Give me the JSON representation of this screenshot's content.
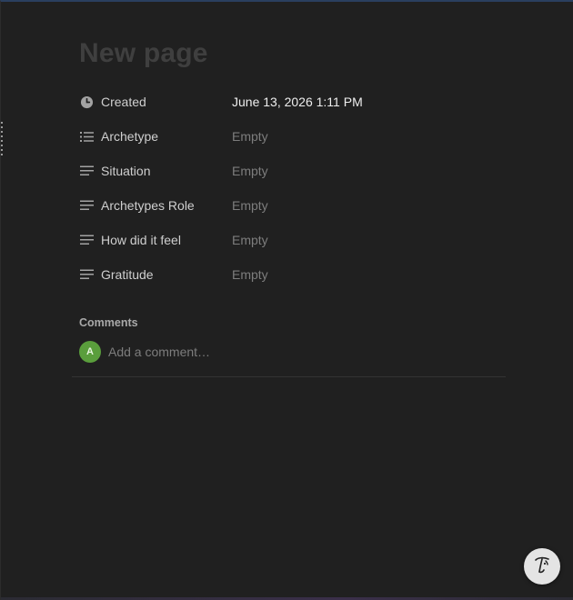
{
  "page": {
    "title": "New page"
  },
  "properties": [
    {
      "name": "Created",
      "value": "June 13, 2026 1:11 PM",
      "icon": "clock-icon",
      "filled": true
    },
    {
      "name": "Archetype",
      "value": "Empty",
      "icon": "list-icon",
      "filled": false
    },
    {
      "name": "Situation",
      "value": "Empty",
      "icon": "text-lines-icon",
      "filled": false
    },
    {
      "name": "Archetypes Role",
      "value": "Empty",
      "icon": "text-lines-icon",
      "filled": false
    },
    {
      "name": "How did it feel",
      "value": "Empty",
      "icon": "text-lines-icon",
      "filled": false
    },
    {
      "name": "Gratitude",
      "value": "Empty",
      "icon": "text-lines-icon",
      "filled": false
    }
  ],
  "comments": {
    "heading": "Comments",
    "avatar_initial": "A",
    "placeholder": "Add a comment…"
  },
  "colors": {
    "background": "#202020",
    "avatar": "#5a9e3c",
    "muted_text": "#7d7d7d"
  },
  "help_button": {
    "icon": "notion-face-icon"
  }
}
